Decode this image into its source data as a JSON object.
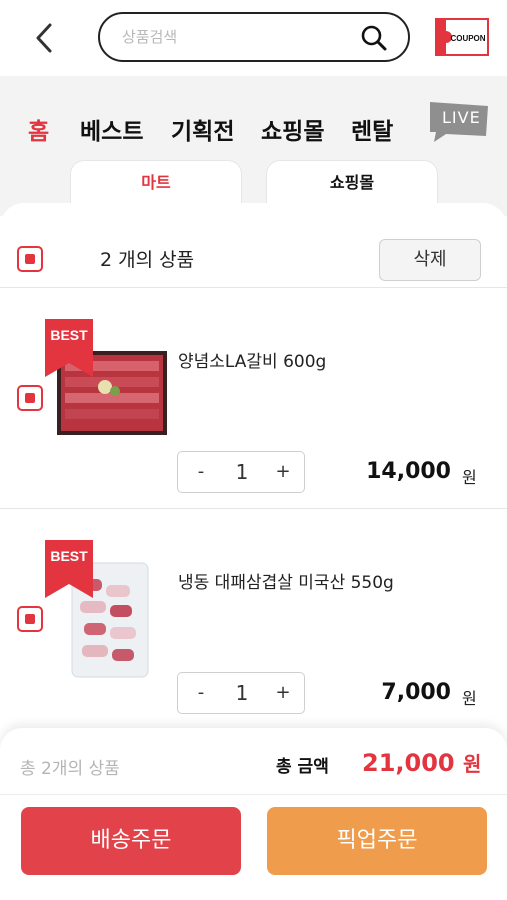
{
  "search": {
    "placeholder": "상품검색"
  },
  "coupon": {
    "label": "COUPON"
  },
  "nav": {
    "items": [
      "홈",
      "베스트",
      "기획전",
      "쇼핑몰",
      "렌탈"
    ],
    "live_label": "LIVE"
  },
  "subtabs": {
    "mart": "마트",
    "mall": "쇼핑몰"
  },
  "cart": {
    "count_text": "2 개의 상품",
    "delete_label": "삭제",
    "items": [
      {
        "badge": "BEST",
        "name": "양념소LA갈비 600g",
        "quantity_minus": "-",
        "quantity": "1",
        "quantity_plus": "+",
        "price": "14,000",
        "unit": "원"
      },
      {
        "badge": "BEST",
        "name": "냉동 대패삼겹살 미국산 550g",
        "quantity_minus": "-",
        "quantity": "1",
        "quantity_plus": "+",
        "price": "7,000",
        "unit": "원"
      }
    ]
  },
  "summary": {
    "total_items": "총 2개의 상품",
    "total_label": "총 금액",
    "total_value": "21,000",
    "total_unit": "원"
  },
  "buttons": {
    "delivery": "배송주문",
    "pickup": "픽업주문"
  },
  "colors": {
    "accent": "#e2353f",
    "pickup": "#ef9d4c",
    "delivery": "#e2434a"
  }
}
